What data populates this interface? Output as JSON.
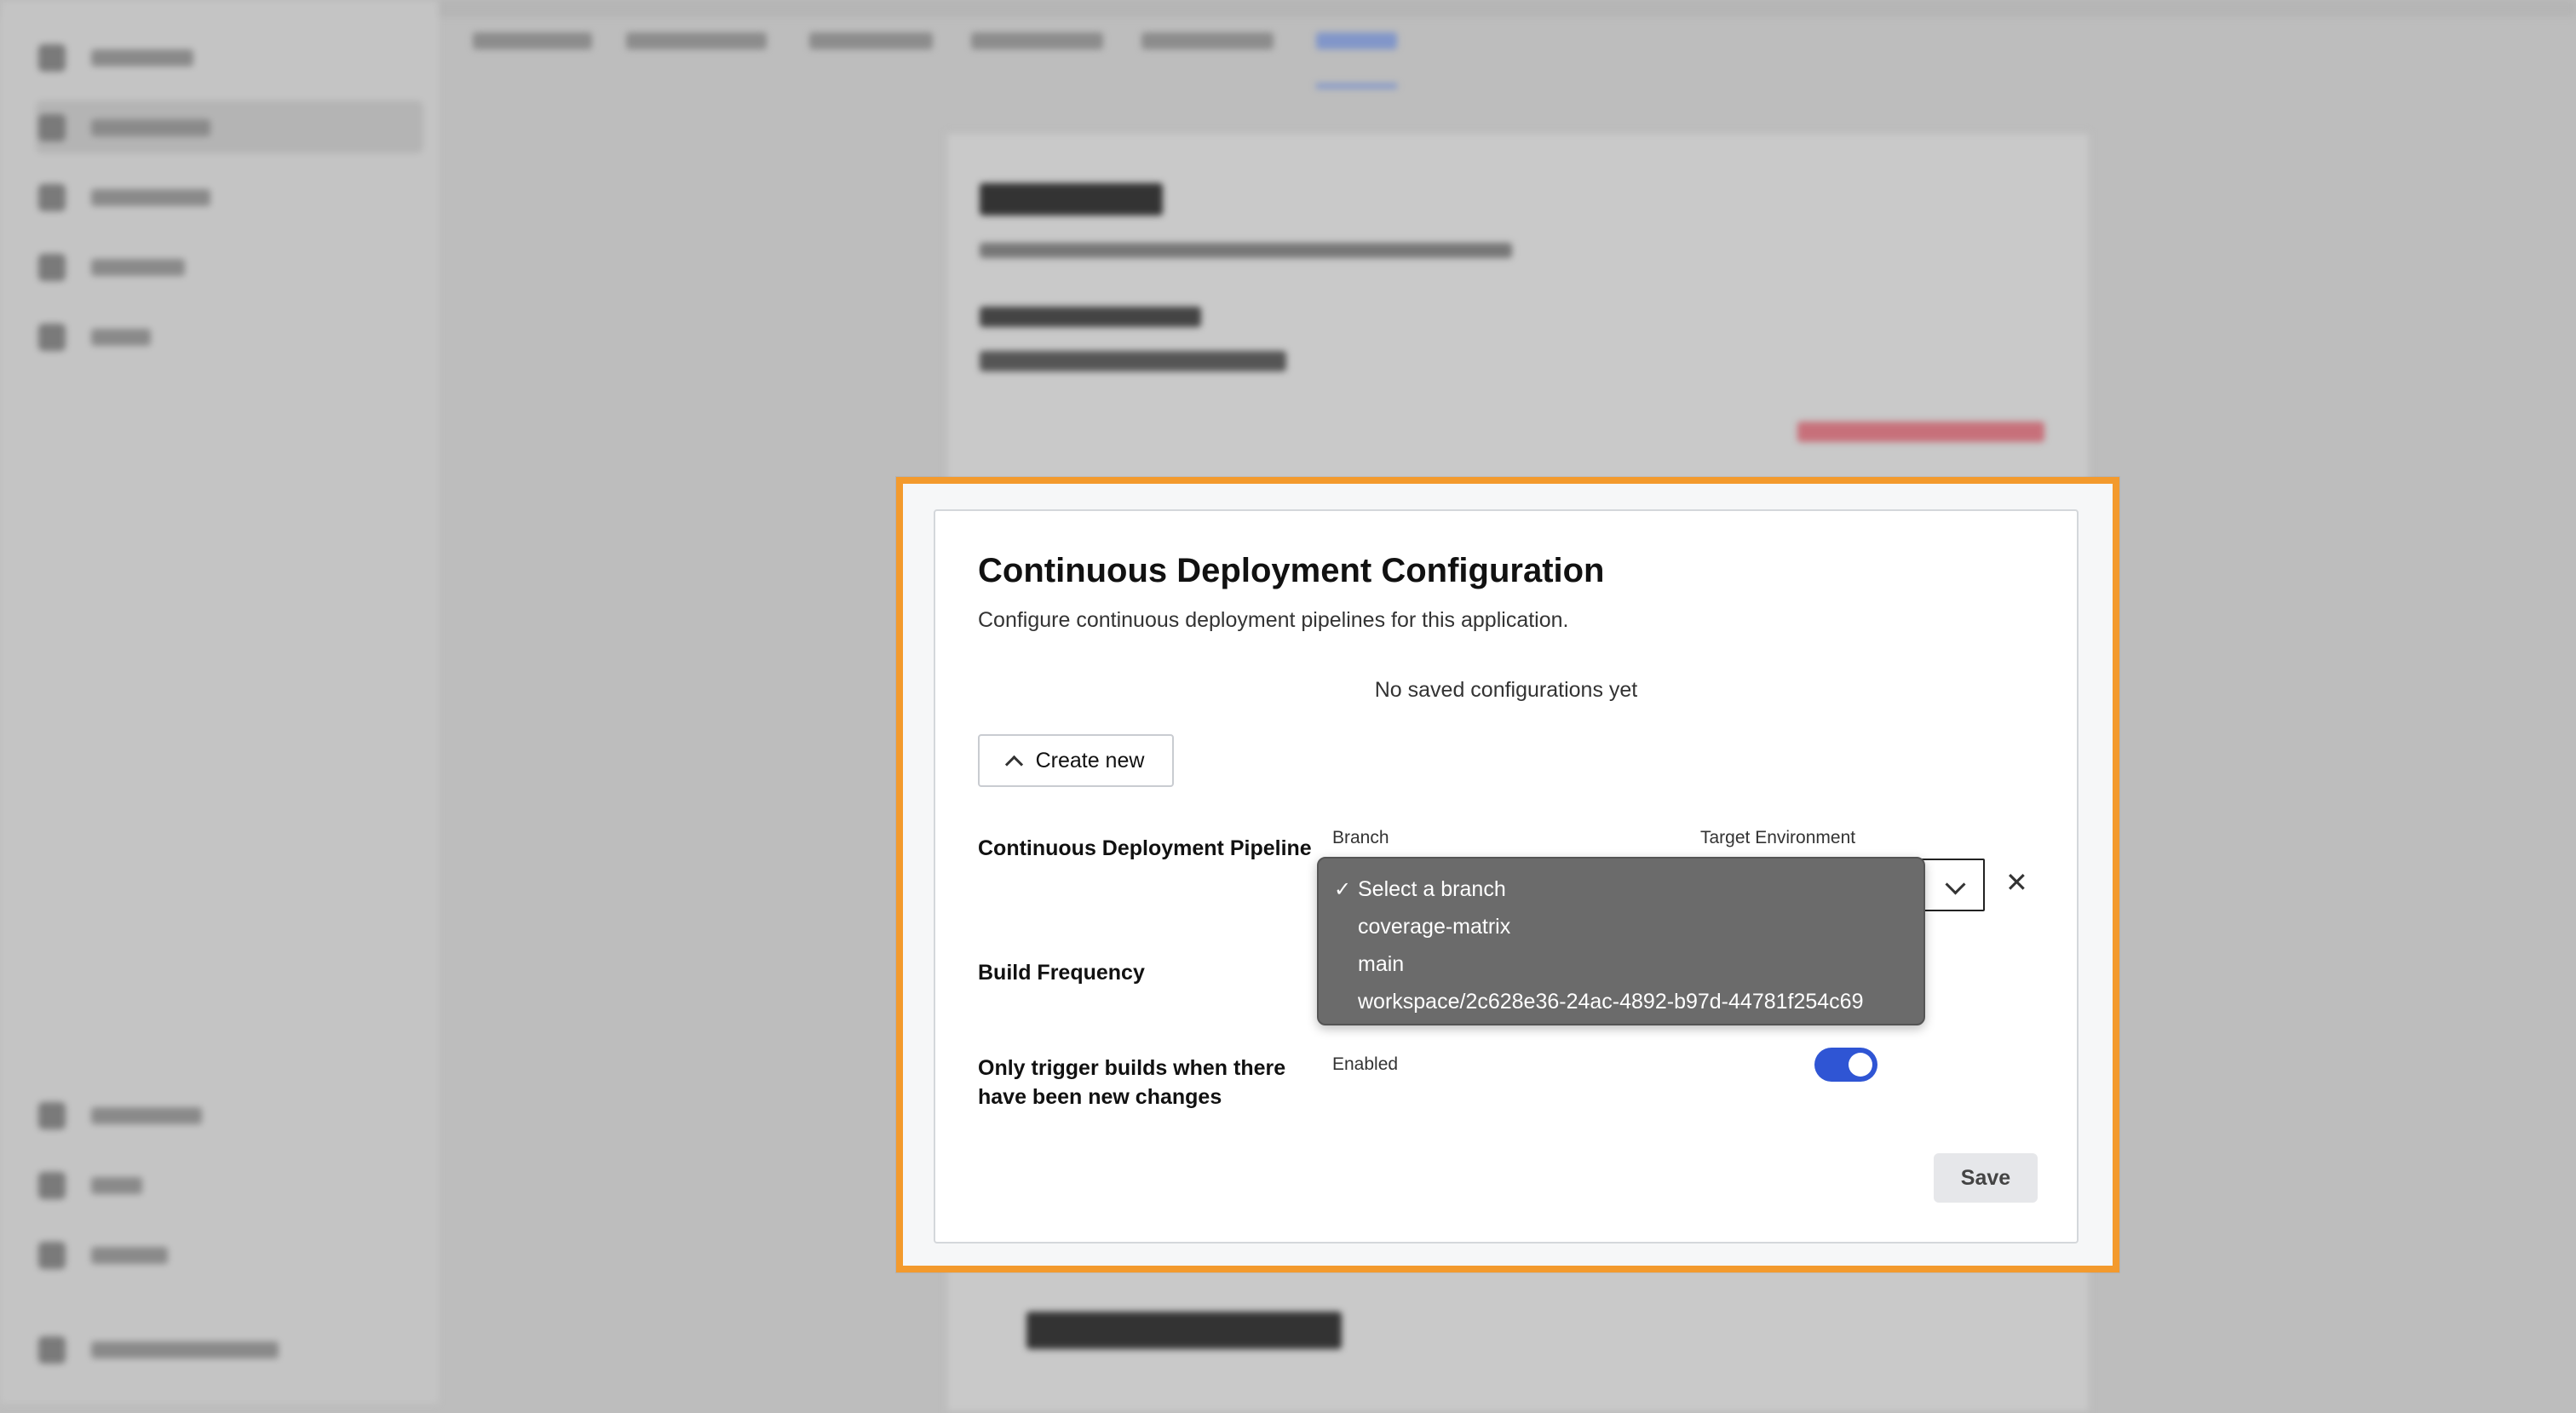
{
  "dialog": {
    "title": "Continuous Deployment Configuration",
    "subtitle": "Configure continuous deployment pipelines for this application.",
    "empty_state": "No saved configurations yet",
    "create_button": "Create new",
    "pipeline_label": "Continuous Deployment Pipeline",
    "branch_label": "Branch",
    "target_env_label": "Target Environment",
    "build_frequency_label": "Build Frequency",
    "trigger_label_line1": "Only trigger builds when there",
    "trigger_label_line2": "have been new changes",
    "toggle_state": "Enabled",
    "save_button": "Save"
  },
  "branch_dropdown": {
    "options": [
      {
        "label": "Select a branch",
        "selected": true
      },
      {
        "label": "coverage-matrix",
        "selected": false
      },
      {
        "label": "main",
        "selected": false
      },
      {
        "label": "workspace/2c628e36-24ac-4892-b97d-44781f254c69",
        "selected": false
      }
    ],
    "check_glyph": "✓"
  },
  "icons": {
    "chevron_up": "chevron-up-icon",
    "chevron_down": "chevron-down-icon",
    "close": "close-icon"
  },
  "colors": {
    "highlight": "#f39a2d",
    "accent": "#2f55d4",
    "dropdown_bg": "#6b6b6b"
  }
}
